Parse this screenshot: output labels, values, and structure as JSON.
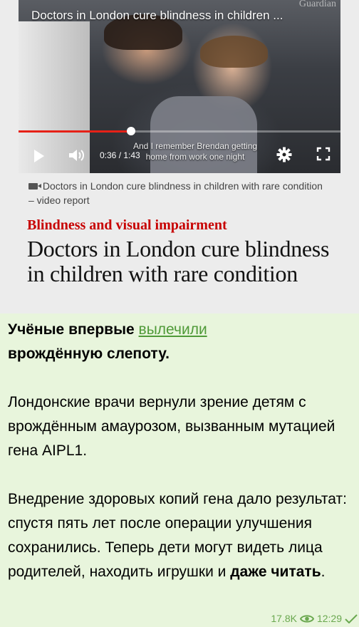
{
  "preview": {
    "video": {
      "title": "Doctors in London cure blindness in children ...",
      "watermark": "Guardian",
      "time": "0:36 / 1:43",
      "subtitle": "And I remember Brendan getting home from work one night",
      "progress": 0.35
    },
    "video_info": "Doctors in London cure blindness in children with rare condition – video report",
    "section": "Blindness and visual impairment",
    "headline": "Doctors in London cure blindness in children with rare condition"
  },
  "message": {
    "line1_bold": "Учёные впервые ",
    "link": "вылечили",
    "line1_bold2": "врождённую слепоту",
    "line1_end": ".",
    "para2": "Лондонские врачи вернули зрение детям с врождённым амаурозом, вызванным мутацией гена AIPL1.",
    "para3_start": "Внедрение здоровых копий гена дало результат: спустя пять лет после операции улучшения сохранились. Теперь дети могут видеть лица родителей, находить игрушки и ",
    "para3_bold": "даже читать",
    "para3_end": "."
  },
  "meta": {
    "views": "17.8K",
    "time": "12:29"
  },
  "colors": {
    "background": "#e8f5dc",
    "link": "#4f9a38",
    "meta": "#6aa84f",
    "section": "#c70000",
    "progress": "#e62117"
  }
}
